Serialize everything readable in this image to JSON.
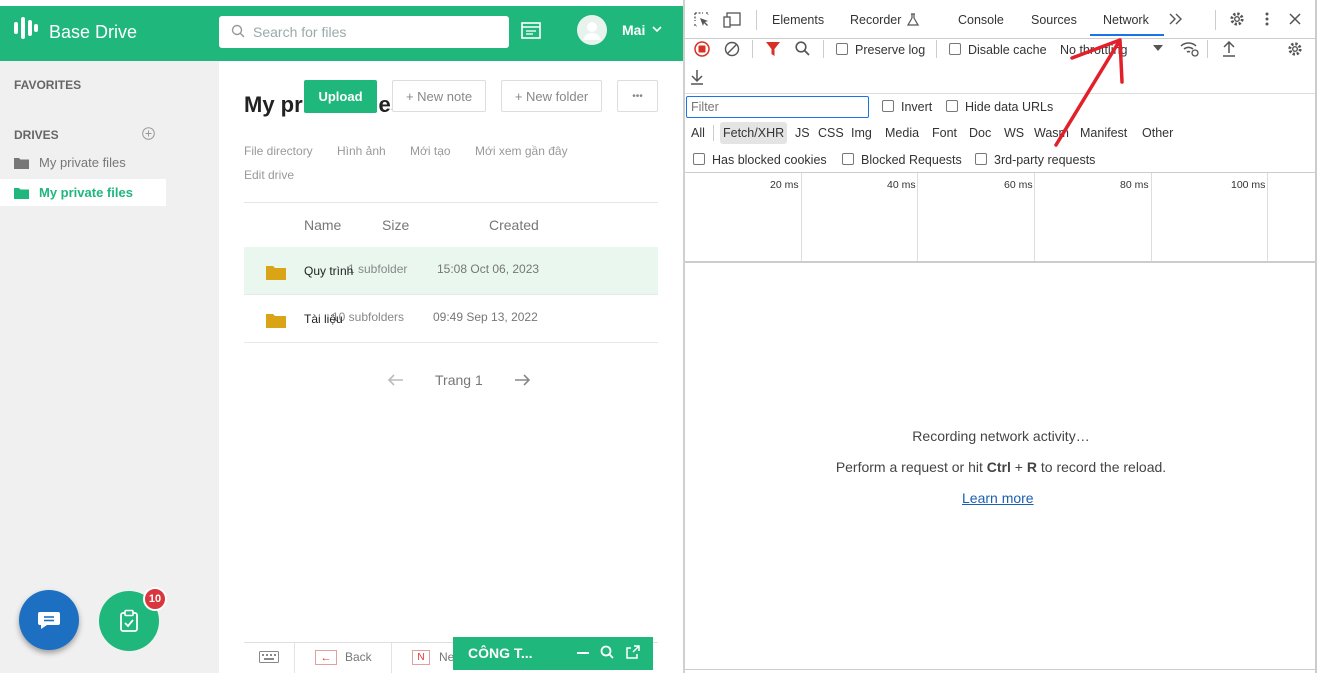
{
  "app": {
    "brand": "Base Drive",
    "search_placeholder": "Search for files",
    "user": "Mai"
  },
  "sidebar": {
    "favorites": "FAVORITES",
    "drives": "DRIVES",
    "items": [
      {
        "label": "My private files"
      },
      {
        "label": "My private files"
      }
    ]
  },
  "main": {
    "title": "My private files",
    "upload": "Upload",
    "new_note": "+ New note",
    "new_folder": "+ New folder",
    "more": "•••",
    "tabs": [
      "File directory",
      "Hình ảnh",
      "Mới tạo",
      "Mới xem gần đây",
      "Edit drive"
    ],
    "columns": {
      "name": "Name",
      "size": "Size",
      "created": "Created"
    },
    "rows": [
      {
        "name": "Quy trình",
        "size": "1 subfolder",
        "created": "15:08 Oct 06, 2023"
      },
      {
        "name": "Tài liệu",
        "size": "10 subfolders",
        "created": "09:49 Sep 13, 2022"
      }
    ],
    "pager": "Trang 1"
  },
  "bottom": {
    "back": "Back",
    "n_label": "Ne",
    "chat_label": "CÔNG T..."
  },
  "fab": {
    "badge": "10"
  },
  "devtools": {
    "tabs": [
      "Elements",
      "Recorder",
      "Console",
      "Sources",
      "Network"
    ],
    "preserve_log": "Preserve log",
    "disable_cache": "Disable cache",
    "throttling": "No throttling",
    "filter_placeholder": "Filter",
    "invert": "Invert",
    "hide_data_urls": "Hide data URLs",
    "types": [
      "All",
      "Fetch/XHR",
      "JS",
      "CSS",
      "Img",
      "Media",
      "Font",
      "Doc",
      "WS",
      "Wasm",
      "Manifest",
      "Other"
    ],
    "has_blocked_cookies": "Has blocked cookies",
    "blocked_requests": "Blocked Requests",
    "third_party": "3rd-party requests",
    "timeline": [
      "20 ms",
      "40 ms",
      "60 ms",
      "80 ms",
      "100 ms"
    ],
    "recording": "Recording network activity…",
    "perform_pre": "Perform a request or hit",
    "ctrl": "Ctrl",
    "plus": "+",
    "r": "R",
    "perform_post": "to record the reload.",
    "learn_more": "Learn more"
  },
  "colors": {
    "brand_green": "#1fb77c",
    "fab_blue": "#1d6fc2",
    "badge_red": "#d9363e",
    "link_blue": "#1a5fb4",
    "annotation_red": "#e3202a"
  }
}
